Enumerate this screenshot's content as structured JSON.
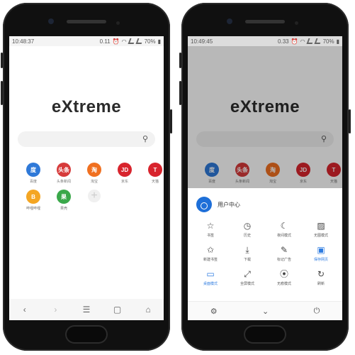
{
  "left_phone": {
    "status": {
      "time": "10:48:37",
      "speed": "0.11",
      "battery": "70%"
    },
    "logo": "eXtreme",
    "search": {
      "icon": "search-icon"
    },
    "shortcuts": [
      {
        "name": "shortcut-baidu",
        "label": "百度",
        "glyph": "度",
        "color": "#2f79d8"
      },
      {
        "name": "shortcut-toutiao",
        "label": "头条新闻",
        "glyph": "头条",
        "color": "#d63a3a"
      },
      {
        "name": "shortcut-taobao",
        "label": "淘宝",
        "glyph": "淘",
        "color": "#f07020"
      },
      {
        "name": "shortcut-jd",
        "label": "京东",
        "glyph": "JD",
        "color": "#d8242d"
      },
      {
        "name": "shortcut-tmall",
        "label": "天猫",
        "glyph": "T",
        "color": "#d8242d"
      },
      {
        "name": "shortcut-bilibili",
        "label": "哔哩哔哩",
        "glyph": "B",
        "color": "#f4a623"
      },
      {
        "name": "shortcut-guoke",
        "label": "果壳",
        "glyph": "果",
        "color": "#3aa84a"
      }
    ],
    "nav": {
      "back": "‹",
      "forward": "›",
      "menu": "☰",
      "tabs": "▢",
      "home": "⌂"
    }
  },
  "right_phone": {
    "status": {
      "time": "10:49:45",
      "speed": "0.33",
      "battery": "70%"
    },
    "logo": "eXtreme",
    "shortcuts": [
      {
        "name": "shortcut-baidu",
        "label": "百度",
        "glyph": "度",
        "color": "#2f79d8"
      },
      {
        "name": "shortcut-toutiao",
        "label": "头条新闻",
        "glyph": "头条",
        "color": "#d63a3a"
      },
      {
        "name": "shortcut-taobao",
        "label": "淘宝",
        "glyph": "淘",
        "color": "#f07020"
      },
      {
        "name": "shortcut-jd",
        "label": "京东",
        "glyph": "JD",
        "color": "#d8242d"
      },
      {
        "name": "shortcut-tmall",
        "label": "天猫",
        "glyph": "T",
        "color": "#d8242d"
      }
    ],
    "menu": {
      "user_label": "用户中心",
      "items": [
        {
          "name": "bookmarks",
          "label": "书签",
          "icon": "☆",
          "active": false
        },
        {
          "name": "history",
          "label": "历史",
          "icon": "◷",
          "active": false
        },
        {
          "name": "night-mode",
          "label": "夜间模式",
          "icon": "☾",
          "active": false
        },
        {
          "name": "no-image-mode",
          "label": "无图模式",
          "icon": "▨",
          "active": false
        },
        {
          "name": "add-bookmark",
          "label": "新建书签",
          "icon": "✩",
          "active": false
        },
        {
          "name": "downloads",
          "label": "下载",
          "icon": "⤓",
          "active": false
        },
        {
          "name": "mark-ads",
          "label": "标记广告",
          "icon": "✎",
          "active": false
        },
        {
          "name": "save-page",
          "label": "保存网页",
          "icon": "▣",
          "active": true
        },
        {
          "name": "desktop-mode",
          "label": "桌面模式",
          "icon": "▭",
          "active": true
        },
        {
          "name": "fullscreen",
          "label": "全屏模式",
          "icon": "⤢",
          "active": false
        },
        {
          "name": "incognito",
          "label": "无痕模式",
          "icon": "⦿",
          "active": false
        },
        {
          "name": "refresh",
          "label": "刷新",
          "icon": "↻",
          "active": false
        }
      ],
      "bottom": {
        "settings": "⚙",
        "collapse": "⌄",
        "power": "⏻"
      }
    }
  }
}
